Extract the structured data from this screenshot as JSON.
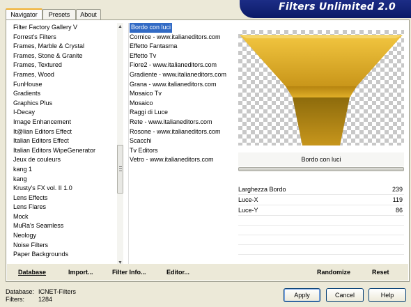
{
  "app": {
    "title": "Filters Unlimited 2.0"
  },
  "tabs": [
    {
      "label": "Navigator",
      "active": true
    },
    {
      "label": "Presets"
    },
    {
      "label": "About"
    }
  ],
  "categories": [
    "Filter Factory Gallery V",
    "Forrest's Filters",
    "Frames, Marble & Crystal",
    "Frames, Stone & Granite",
    "Frames, Textured",
    "Frames, Wood",
    "FunHouse",
    "Gradients",
    "Graphics Plus",
    "I-Decay",
    "Image Enhancement",
    "It@lian Editors Effect",
    "Italian Editors Effect",
    "Italian Editors WipeGenerator",
    "Jeux de couleurs",
    "kang 1",
    "kang",
    "Krusty's FX vol. II 1.0",
    "Lens Effects",
    "Lens Flares",
    "Mock",
    "MuRa's Seamless",
    "Neology",
    "Noise Filters",
    "Paper Backgrounds"
  ],
  "filters": [
    "Bordo con luci",
    "Cornice - www.italianeditors.com",
    "Effetto Fantasma",
    "Effetto Tv",
    "Fiore2 - www.italianeditors.com",
    "Gradiente - www.italianeditors.com",
    "Grana - www.italianeditors.com",
    "Mosaico Tv",
    "Mosaico",
    "Raggi di Luce",
    "Rete - www.italianeditors.com",
    "Rosone - www.italianeditors.com",
    "Scacchi",
    "Tv Editors",
    "Vetro - www.italianeditors.com"
  ],
  "selected_filter": "Bordo con luci",
  "sliders": [
    {
      "label": "Larghezza Bordo",
      "value": "239"
    },
    {
      "label": "Luce-X",
      "value": "119"
    },
    {
      "label": "Luce-Y",
      "value": "86"
    }
  ],
  "bottom_buttons": {
    "database": "Database",
    "import": "Import...",
    "filter_info": "Filter Info...",
    "editor": "Editor...",
    "randomize": "Randomize",
    "reset": "Reset"
  },
  "info": {
    "database_label": "Database:",
    "database_value": "ICNET-Filters",
    "filters_label": "Filters:",
    "filters_value": "1284"
  },
  "dialog_buttons": {
    "apply": "Apply",
    "cancel": "Cancel",
    "help": "Help"
  },
  "colors": {
    "selection": "#316ac5",
    "logo_bg": "#0b1a67",
    "preview_gold": "#d9a718"
  }
}
